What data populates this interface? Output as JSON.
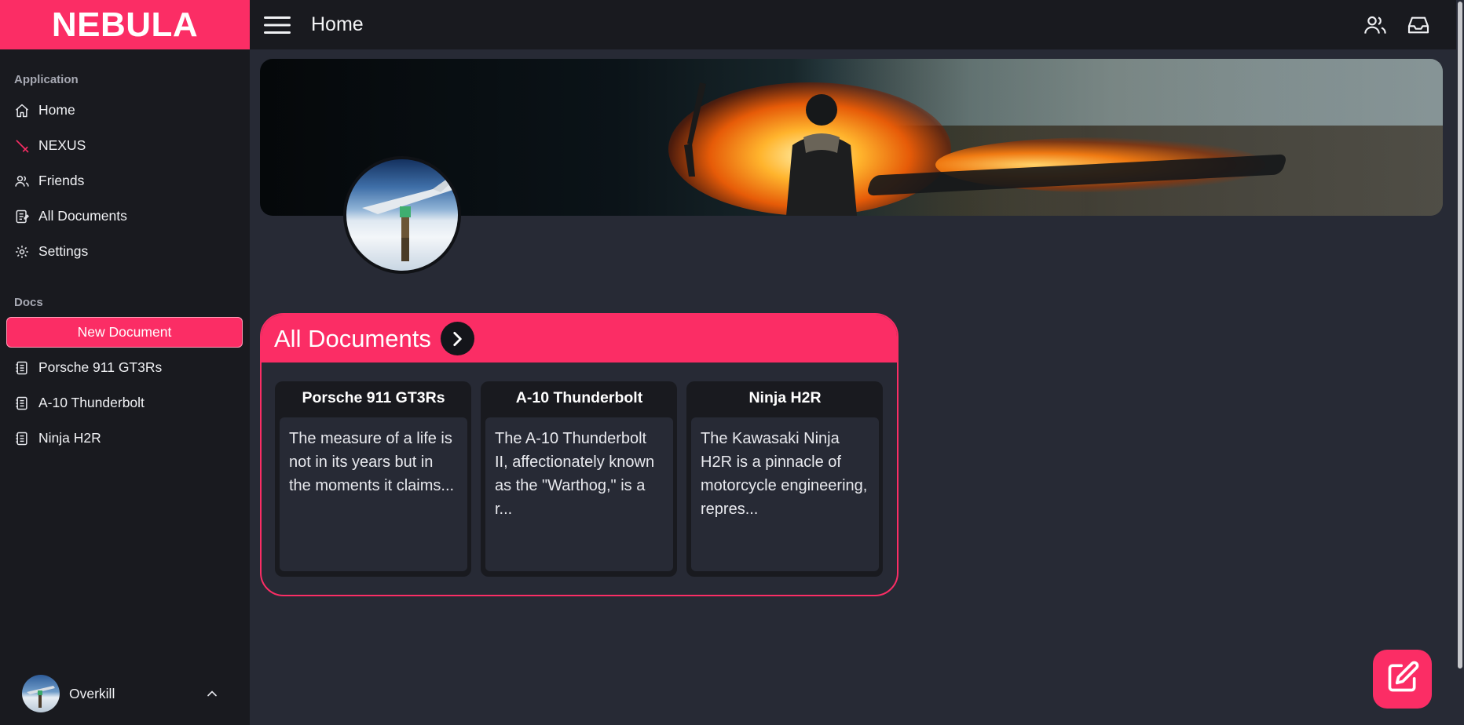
{
  "app": {
    "brand": "NEBULA",
    "title": "Home"
  },
  "sidebar": {
    "sections": {
      "application": "Application",
      "docs": "Docs"
    },
    "nav": [
      {
        "label": "Home",
        "icon": "home-icon"
      },
      {
        "label": "NEXUS",
        "icon": "sword-icon"
      },
      {
        "label": "Friends",
        "icon": "users-icon"
      },
      {
        "label": "All Documents",
        "icon": "documents-icon"
      },
      {
        "label": "Settings",
        "icon": "gear-icon"
      }
    ],
    "new_document_label": "New Document",
    "documents": [
      {
        "label": "Porsche 911 GT3Rs",
        "icon": "notebook-icon"
      },
      {
        "label": "A-10 Thunderbolt",
        "icon": "notebook-icon"
      },
      {
        "label": "Ninja H2R",
        "icon": "notebook-icon"
      }
    ],
    "user": {
      "name": "Overkill"
    }
  },
  "topbar": {
    "icons": [
      "users-icon",
      "inbox-icon"
    ]
  },
  "documents_panel": {
    "title": "All Documents",
    "cards": [
      {
        "title": "Porsche 911 GT3Rs",
        "excerpt": "The measure of a life is not in its years but in the moments it claims..."
      },
      {
        "title": "A-10 Thunderbolt",
        "excerpt": "The A-10 Thunderbolt II, affectionately known as the \"Warthog,\" is a r..."
      },
      {
        "title": "Ninja H2R",
        "excerpt": "The Kawasaki Ninja H2R is a pinnacle of motorcycle engineering, repres..."
      }
    ]
  },
  "colors": {
    "accent": "#fb2d65",
    "sidebar_bg": "#191a1f",
    "main_bg": "#272a35"
  }
}
